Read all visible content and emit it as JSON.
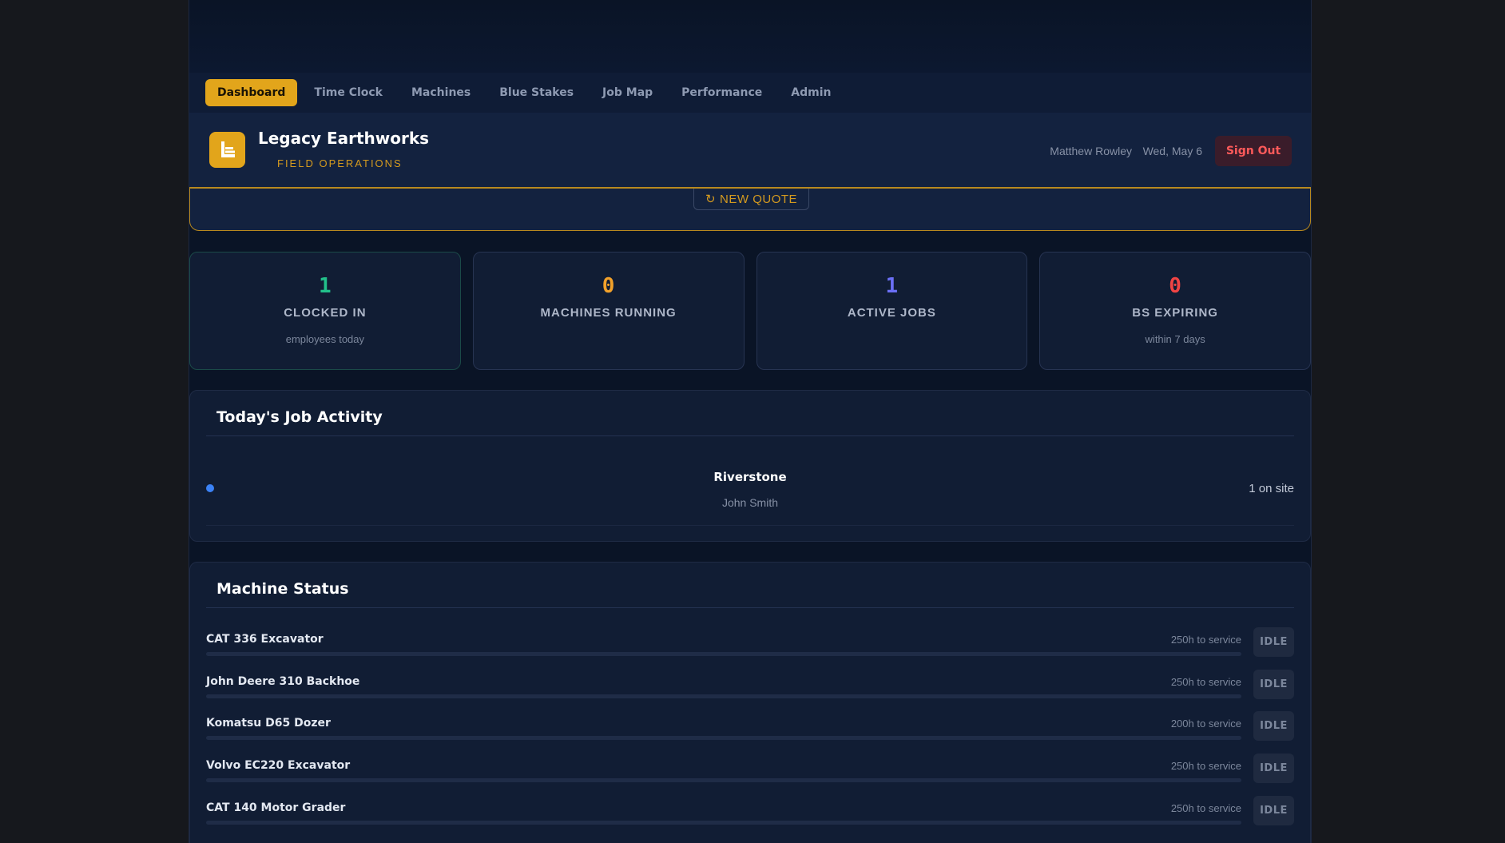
{
  "nav": {
    "tabs": [
      {
        "label": "Dashboard",
        "active": true
      },
      {
        "label": "Time Clock"
      },
      {
        "label": "Machines"
      },
      {
        "label": "Blue Stakes"
      },
      {
        "label": "Job Map"
      },
      {
        "label": "Performance"
      },
      {
        "label": "Admin"
      }
    ]
  },
  "header": {
    "brand_name": "Legacy Earthworks",
    "brand_sub": "FIELD OPERATIONS",
    "user_name": "Matthew Rowley",
    "date": "Wed, May 6",
    "sign_out_label": "Sign Out"
  },
  "quote": {
    "icon": "refresh-icon",
    "button_label": "NEW QUOTE"
  },
  "stats": [
    {
      "value": "1",
      "label": "CLOCKED IN",
      "sub": "employees today",
      "color": "#22c08a"
    },
    {
      "value": "0",
      "label": "MACHINES RUNNING",
      "sub": "",
      "color": "#f2a12a"
    },
    {
      "value": "1",
      "label": "ACTIVE JOBS",
      "sub": "",
      "color": "#6b6ff5"
    },
    {
      "value": "0",
      "label": "BS EXPIRING",
      "sub": "within 7 days",
      "color": "#f04444"
    }
  ],
  "job_activity": {
    "title": "Today's Job Activity",
    "jobs": [
      {
        "name": "Riverstone",
        "person": "John Smith",
        "count": "1 on site",
        "dot_color": "#3b82f6"
      }
    ]
  },
  "machine_status": {
    "title": "Machine Status",
    "machines": [
      {
        "name": "CAT 336 Excavator",
        "service": "250h to service",
        "status": "IDLE",
        "progress": 0
      },
      {
        "name": "John Deere 310 Backhoe",
        "service": "250h to service",
        "status": "IDLE",
        "progress": 0
      },
      {
        "name": "Komatsu D65 Dozer",
        "service": "200h to service",
        "status": "IDLE",
        "progress": 0
      },
      {
        "name": "Volvo EC220 Excavator",
        "service": "250h to service",
        "status": "IDLE",
        "progress": 0
      },
      {
        "name": "CAT 140 Motor Grader",
        "service": "250h to service",
        "status": "IDLE",
        "progress": 0
      }
    ]
  }
}
